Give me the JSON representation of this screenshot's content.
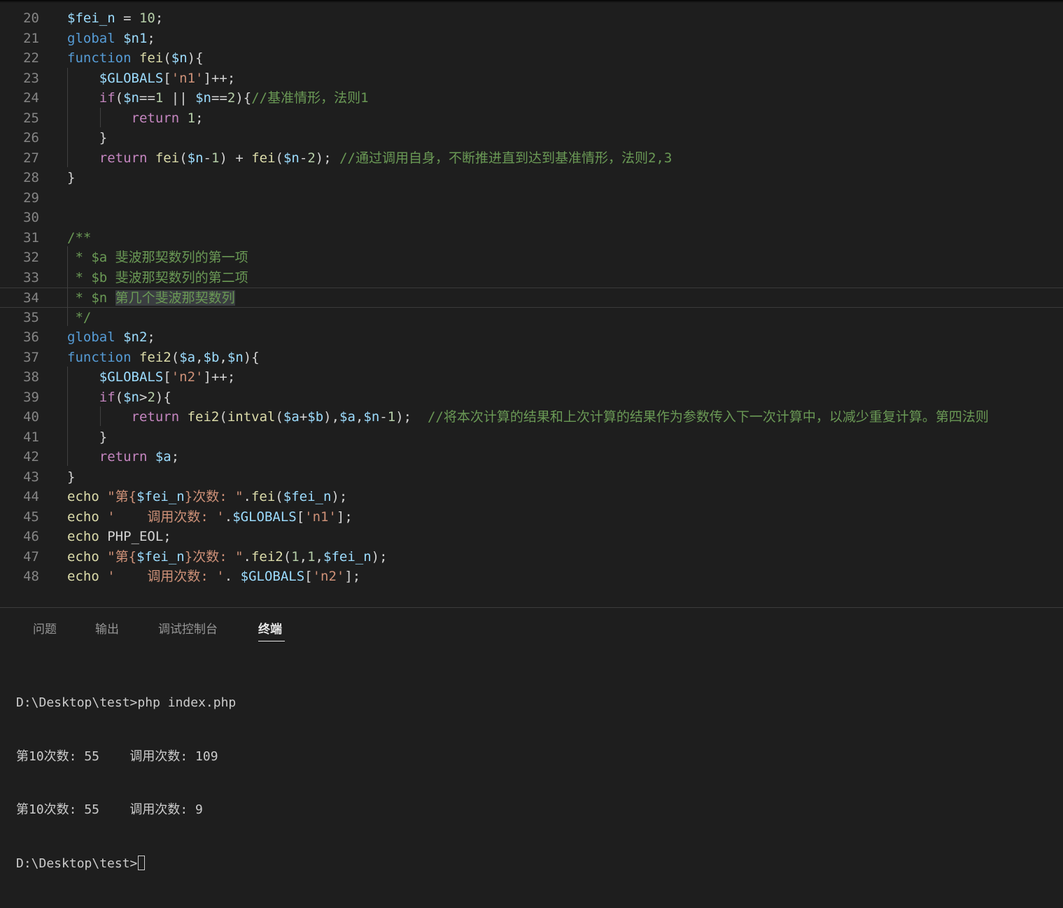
{
  "editor": {
    "lines": [
      {
        "num": "20",
        "tokens": [
          [
            "var",
            "$fei_n"
          ],
          [
            "op",
            " = "
          ],
          [
            "num",
            "10"
          ],
          [
            "op",
            ";"
          ]
        ]
      },
      {
        "num": "21",
        "tokens": [
          [
            "kw",
            "global"
          ],
          [
            "op",
            " "
          ],
          [
            "var",
            "$n1"
          ],
          [
            "op",
            ";"
          ]
        ]
      },
      {
        "num": "22",
        "tokens": [
          [
            "kw",
            "function"
          ],
          [
            "op",
            " "
          ],
          [
            "fn",
            "fei"
          ],
          [
            "op",
            "("
          ],
          [
            "var",
            "$n"
          ],
          [
            "op",
            "){"
          ]
        ]
      },
      {
        "num": "23",
        "tokens": [
          [
            "op",
            "    "
          ],
          [
            "var",
            "$GLOBALS"
          ],
          [
            "op",
            "["
          ],
          [
            "str",
            "'n1'"
          ],
          [
            "op",
            "]++;"
          ]
        ]
      },
      {
        "num": "24",
        "tokens": [
          [
            "op",
            "    "
          ],
          [
            "ctl",
            "if"
          ],
          [
            "op",
            "("
          ],
          [
            "var",
            "$n"
          ],
          [
            "op",
            "=="
          ],
          [
            "num",
            "1"
          ],
          [
            "op",
            " || "
          ],
          [
            "var",
            "$n"
          ],
          [
            "op",
            "=="
          ],
          [
            "num",
            "2"
          ],
          [
            "op",
            "){"
          ],
          [
            "com",
            "//基准情形，法则1"
          ]
        ]
      },
      {
        "num": "25",
        "tokens": [
          [
            "op",
            "        "
          ],
          [
            "ctl",
            "return"
          ],
          [
            "op",
            " "
          ],
          [
            "num",
            "1"
          ],
          [
            "op",
            ";"
          ]
        ]
      },
      {
        "num": "26",
        "tokens": [
          [
            "op",
            "    }"
          ]
        ]
      },
      {
        "num": "27",
        "tokens": [
          [
            "op",
            "    "
          ],
          [
            "ctl",
            "return"
          ],
          [
            "op",
            " "
          ],
          [
            "fn",
            "fei"
          ],
          [
            "op",
            "("
          ],
          [
            "var",
            "$n"
          ],
          [
            "op",
            "-"
          ],
          [
            "num",
            "1"
          ],
          [
            "op",
            ") + "
          ],
          [
            "fn",
            "fei"
          ],
          [
            "op",
            "("
          ],
          [
            "var",
            "$n"
          ],
          [
            "op",
            "-"
          ],
          [
            "num",
            "2"
          ],
          [
            "op",
            "); "
          ],
          [
            "com",
            "//通过调用自身，不断推进直到达到基准情形，法则2,3"
          ]
        ]
      },
      {
        "num": "28",
        "tokens": [
          [
            "op",
            "}"
          ]
        ]
      },
      {
        "num": "29",
        "tokens": []
      },
      {
        "num": "30",
        "tokens": []
      },
      {
        "num": "31",
        "tokens": [
          [
            "com",
            "/**"
          ]
        ]
      },
      {
        "num": "32",
        "tokens": [
          [
            "com",
            " * $a 斐波那契数列的第一项"
          ]
        ]
      },
      {
        "num": "33",
        "tokens": [
          [
            "com",
            " * $b 斐波那契数列的第二项"
          ]
        ]
      },
      {
        "num": "34",
        "tokens": [
          [
            "com",
            " * $n "
          ],
          [
            "comsel",
            "第几个斐波那契数列"
          ]
        ]
      },
      {
        "num": "35",
        "tokens": [
          [
            "com",
            " */"
          ]
        ]
      },
      {
        "num": "36",
        "tokens": [
          [
            "kw",
            "global"
          ],
          [
            "op",
            " "
          ],
          [
            "var",
            "$n2"
          ],
          [
            "op",
            ";"
          ]
        ]
      },
      {
        "num": "37",
        "tokens": [
          [
            "kw",
            "function"
          ],
          [
            "op",
            " "
          ],
          [
            "fn",
            "fei2"
          ],
          [
            "op",
            "("
          ],
          [
            "var",
            "$a"
          ],
          [
            "op",
            ","
          ],
          [
            "var",
            "$b"
          ],
          [
            "op",
            ","
          ],
          [
            "var",
            "$n"
          ],
          [
            "op",
            "){"
          ]
        ]
      },
      {
        "num": "38",
        "tokens": [
          [
            "op",
            "    "
          ],
          [
            "var",
            "$GLOBALS"
          ],
          [
            "op",
            "["
          ],
          [
            "str",
            "'n2'"
          ],
          [
            "op",
            "]++;"
          ]
        ]
      },
      {
        "num": "39",
        "tokens": [
          [
            "op",
            "    "
          ],
          [
            "ctl",
            "if"
          ],
          [
            "op",
            "("
          ],
          [
            "var",
            "$n"
          ],
          [
            "op",
            ">"
          ],
          [
            "num",
            "2"
          ],
          [
            "op",
            "){"
          ]
        ]
      },
      {
        "num": "40",
        "tokens": [
          [
            "op",
            "        "
          ],
          [
            "ctl",
            "return"
          ],
          [
            "op",
            " "
          ],
          [
            "fn",
            "fei2"
          ],
          [
            "op",
            "("
          ],
          [
            "fn",
            "intval"
          ],
          [
            "op",
            "("
          ],
          [
            "var",
            "$a"
          ],
          [
            "op",
            "+"
          ],
          [
            "var",
            "$b"
          ],
          [
            "op",
            "),"
          ],
          [
            "var",
            "$a"
          ],
          [
            "op",
            ","
          ],
          [
            "var",
            "$n"
          ],
          [
            "op",
            "-"
          ],
          [
            "num",
            "1"
          ],
          [
            "op",
            ");  "
          ],
          [
            "com",
            "//将本次计算的结果和上次计算的结果作为参数传入下一次计算中，以减少重复计算。第四法则"
          ]
        ]
      },
      {
        "num": "41",
        "tokens": [
          [
            "op",
            "    }"
          ]
        ]
      },
      {
        "num": "42",
        "tokens": [
          [
            "op",
            "    "
          ],
          [
            "ctl",
            "return"
          ],
          [
            "op",
            " "
          ],
          [
            "var",
            "$a"
          ],
          [
            "op",
            ";"
          ]
        ]
      },
      {
        "num": "43",
        "tokens": [
          [
            "op",
            "}"
          ]
        ]
      },
      {
        "num": "44",
        "tokens": [
          [
            "fn",
            "echo"
          ],
          [
            "op",
            " "
          ],
          [
            "str",
            "\"第{"
          ],
          [
            "var",
            "$fei_n"
          ],
          [
            "str",
            "}次数: \""
          ],
          [
            "op",
            "."
          ],
          [
            "fn",
            "fei"
          ],
          [
            "op",
            "("
          ],
          [
            "var",
            "$fei_n"
          ],
          [
            "op",
            ");"
          ]
        ]
      },
      {
        "num": "45",
        "tokens": [
          [
            "fn",
            "echo"
          ],
          [
            "op",
            " "
          ],
          [
            "str",
            "'    调用次数: '"
          ],
          [
            "op",
            "."
          ],
          [
            "var",
            "$GLOBALS"
          ],
          [
            "op",
            "["
          ],
          [
            "str",
            "'n1'"
          ],
          [
            "op",
            "];"
          ]
        ]
      },
      {
        "num": "46",
        "tokens": [
          [
            "fn",
            "echo"
          ],
          [
            "op",
            " PHP_EOL;"
          ]
        ]
      },
      {
        "num": "47",
        "tokens": [
          [
            "fn",
            "echo"
          ],
          [
            "op",
            " "
          ],
          [
            "str",
            "\"第{"
          ],
          [
            "var",
            "$fei_n"
          ],
          [
            "str",
            "}次数: \""
          ],
          [
            "op",
            "."
          ],
          [
            "fn",
            "fei2"
          ],
          [
            "op",
            "("
          ],
          [
            "num",
            "1"
          ],
          [
            "op",
            ","
          ],
          [
            "num",
            "1"
          ],
          [
            "op",
            ","
          ],
          [
            "var",
            "$fei_n"
          ],
          [
            "op",
            ");"
          ]
        ]
      },
      {
        "num": "48",
        "tokens": [
          [
            "fn",
            "echo"
          ],
          [
            "op",
            " "
          ],
          [
            "str",
            "'    调用次数: '"
          ],
          [
            "op",
            ". "
          ],
          [
            "var",
            "$GLOBALS"
          ],
          [
            "op",
            "["
          ],
          [
            "str",
            "'n2'"
          ],
          [
            "op",
            "];"
          ]
        ]
      }
    ],
    "current_line": "34"
  },
  "panel": {
    "tabs": [
      {
        "id": "problems",
        "label": "问题"
      },
      {
        "id": "output",
        "label": "输出"
      },
      {
        "id": "debug-console",
        "label": "调试控制台"
      },
      {
        "id": "terminal",
        "label": "终端",
        "active": true
      }
    ]
  },
  "terminal": {
    "lines": [
      "D:\\Desktop\\test>php index.php",
      "第10次数: 55    调用次数: 109",
      "第10次数: 55    调用次数: 9"
    ],
    "prompt": "D:\\Desktop\\test>"
  },
  "colors": {
    "background": "#1e1e1e",
    "keyword": "#569cd6",
    "control": "#c586c0",
    "function": "#dcdcaa",
    "variable": "#9cdcfe",
    "number": "#b5cea8",
    "string": "#ce9178",
    "comment": "#6a9955",
    "line_number": "#858585"
  }
}
